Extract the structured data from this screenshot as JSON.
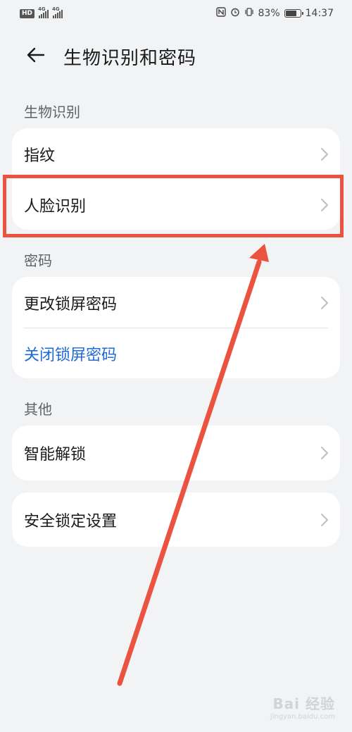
{
  "status_bar": {
    "hd_badge": "HD",
    "net1": "4G",
    "net2": "4G",
    "battery_percent": "83%",
    "battery_level": 0.83,
    "time": "14:37",
    "icons": [
      "nfc-icon",
      "alarm-icon",
      "vibrate-icon",
      "battery-icon"
    ]
  },
  "header": {
    "title": "生物识别和密码",
    "back_icon": "arrow-left-icon"
  },
  "sections": {
    "biometric": {
      "label": "生物识别",
      "items": [
        {
          "label": "指纹"
        },
        {
          "label": "人脸识别"
        }
      ]
    },
    "password": {
      "label": "密码",
      "items": [
        {
          "label": "更改锁屏密码"
        },
        {
          "label": "关闭锁屏密码"
        }
      ]
    },
    "other": {
      "label": "其他",
      "items": [
        {
          "label": "智能解锁"
        }
      ]
    },
    "security_lock": {
      "items": [
        {
          "label": "安全锁定设置"
        }
      ]
    }
  },
  "annotation": {
    "color": "#ec5240",
    "target": "人脸识别"
  },
  "watermark": {
    "main": "Bai 经验",
    "sub": "jingyan.baidu.com"
  }
}
